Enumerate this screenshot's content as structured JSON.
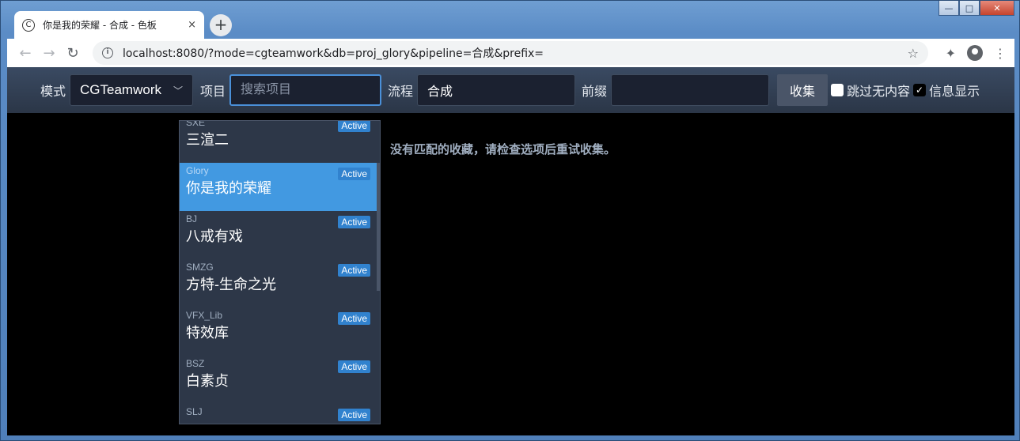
{
  "browser": {
    "tab_title": "你是我的荣耀 - 合成 - 色板",
    "tab_close": "×",
    "newtab_label": "+",
    "url": "localhost:8080/?mode=cgteamwork&db=proj_glory&pipeline=合成&prefix=",
    "favicon_glyph": "C"
  },
  "toolbar": {
    "mode_label": "模式",
    "mode_value": "CGTeamwork",
    "project_label": "项目",
    "project_placeholder": "搜索项目",
    "pipeline_label": "流程",
    "pipeline_value": "合成",
    "prefix_label": "前缀",
    "prefix_value": "",
    "collect_button": "收集",
    "skip_empty_label": "跳过无内容",
    "skip_empty_checked": false,
    "show_info_label": "信息显示",
    "show_info_checked": true
  },
  "projects": [
    {
      "code": "SXE",
      "name": "三渲二",
      "status": "Active"
    },
    {
      "code": "Glory",
      "name": "你是我的荣耀",
      "status": "Active",
      "selected": true
    },
    {
      "code": "BJ",
      "name": "八戒有戏",
      "status": "Active"
    },
    {
      "code": "SMZG",
      "name": "方特-生命之光",
      "status": "Active"
    },
    {
      "code": "VFX_Lib",
      "name": "特效库",
      "status": "Active"
    },
    {
      "code": "BSZ",
      "name": "白素贞",
      "status": "Active"
    },
    {
      "code": "SLJ",
      "name": "",
      "status": "Active"
    }
  ],
  "message": "没有匹配的收藏，请检查选项后重试收集。"
}
